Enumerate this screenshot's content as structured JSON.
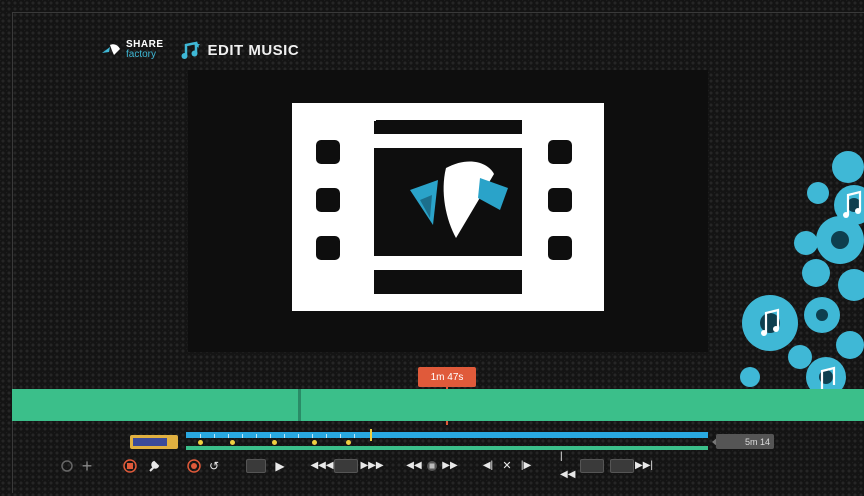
{
  "header": {
    "logo": {
      "share": "SHARE",
      "factory": "factory"
    },
    "mode_title": "EDIT MUSIC"
  },
  "timeline": {
    "playhead_time": "1m 47s",
    "end_time": "5m 14"
  },
  "icons": {
    "add": "plus-icon",
    "delete": "stop-square-icon",
    "settings": "wrench-icon",
    "record": "record-circle-icon",
    "undo": "undo-icon",
    "play": "play-icon",
    "rewind": "rewind-icon",
    "fast_forward": "fast-forward-icon",
    "skip_start": "skip-start-icon",
    "skip_end": "skip-end-icon"
  },
  "colors": {
    "accent_green": "#3bbf8a",
    "accent_blue": "#29a8e0",
    "playhead": "#e05a3a",
    "gear_cyan": "#3fb8d6"
  }
}
